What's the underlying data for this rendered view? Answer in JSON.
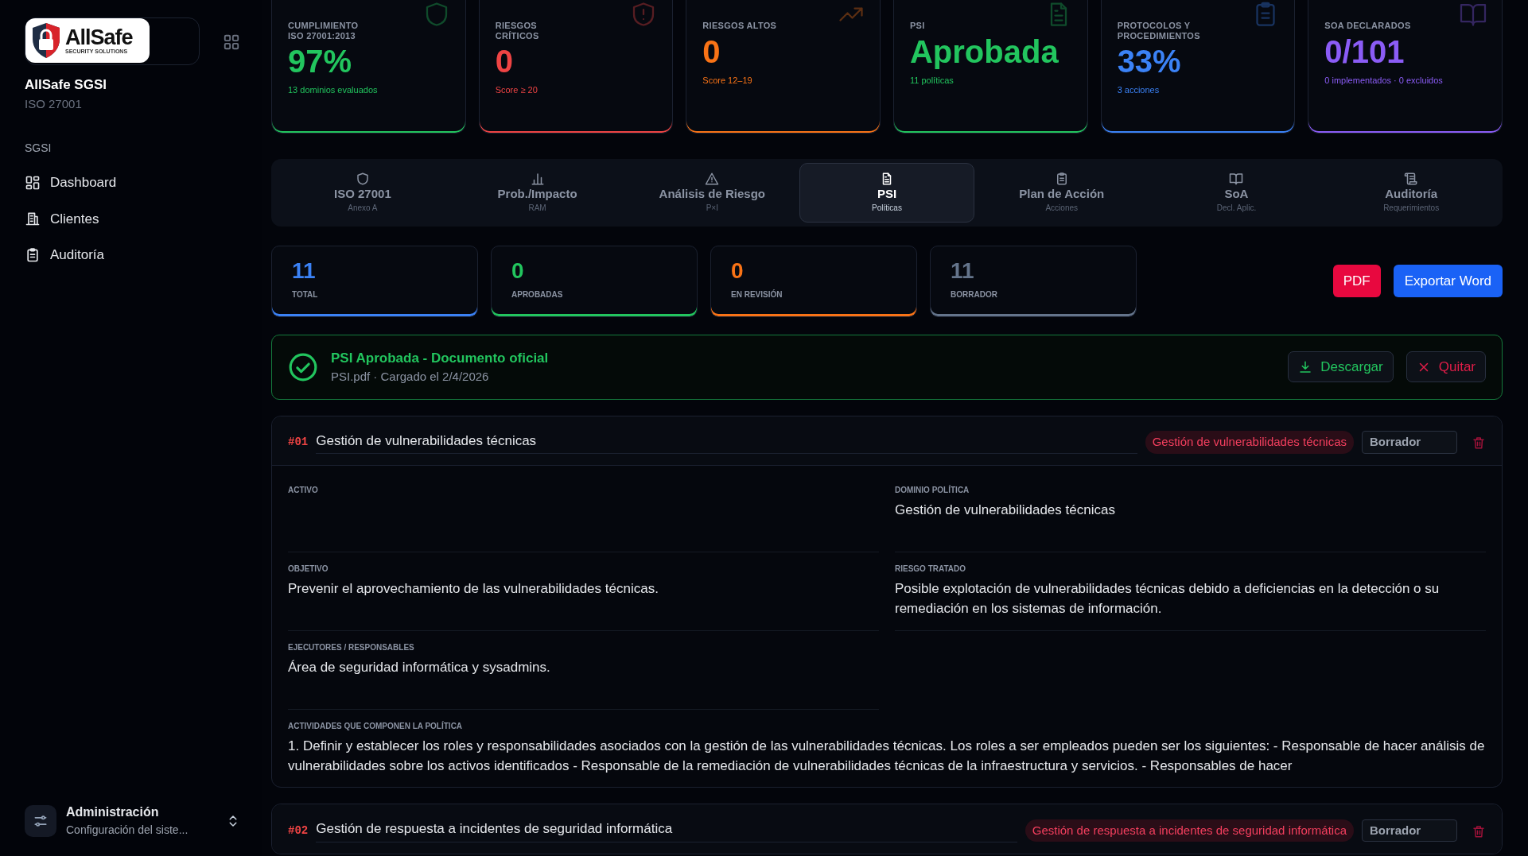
{
  "sidebar": {
    "logo_text": "AllSafe",
    "logo_tagline": "SECURITY SOLUTIONS",
    "brand_title": "AllSafe SGSI",
    "brand_subtitle": "ISO 27001",
    "section": "SGSI",
    "items": [
      {
        "label": "Dashboard",
        "selected": false
      },
      {
        "label": "Clientes",
        "selected": false
      },
      {
        "label": "Auditoría",
        "selected": false
      }
    ],
    "footer": {
      "title": "Administración",
      "subtitle": "Configuración del siste..."
    }
  },
  "kpis": [
    {
      "label": "CUMPLIMIENTO ISO 27001:2013",
      "value": "97%",
      "note": "13 dominios evaluados",
      "color": "#22c55e"
    },
    {
      "label": "RIESGOS CRÍTICOS",
      "value": "0",
      "note": "Score ≥ 20",
      "color": "#ef4444"
    },
    {
      "label": "RIESGOS ALTOS",
      "value": "0",
      "note": "Score 12–19",
      "color": "#f97316"
    },
    {
      "label": "PSI",
      "value": "Aprobada",
      "note": "11 políticas",
      "color": "#22c55e"
    },
    {
      "label": "PROTOCOLOS Y PROCEDIMIENTOS",
      "value": "33%",
      "note": "3 acciones",
      "color": "#3b82f6"
    },
    {
      "label": "SOA DECLARADOS",
      "value": "0/101",
      "note": "0 implementados · 0 excluidos",
      "color": "#8b5cf6"
    }
  ],
  "tabs": [
    {
      "label": "ISO 27001",
      "sub": "Anexo A",
      "selected": false
    },
    {
      "label": "Prob./Impacto",
      "sub": "RAM",
      "selected": false
    },
    {
      "label": "Análisis de Riesgo",
      "sub": "P×I",
      "selected": false
    },
    {
      "label": "PSI",
      "sub": "Políticas",
      "selected": true
    },
    {
      "label": "Plan de Acción",
      "sub": "Acciones",
      "selected": false
    },
    {
      "label": "SoA",
      "sub": "Decl. Aplic.",
      "selected": false
    },
    {
      "label": "Auditoría",
      "sub": "Requerimientos",
      "selected": false
    }
  ],
  "stats": [
    {
      "value": "11",
      "label": "TOTAL",
      "color": "#3b82f6"
    },
    {
      "value": "0",
      "label": "APROBADAS",
      "color": "#22c55e"
    },
    {
      "value": "0",
      "label": "EN REVISIÓN",
      "color": "#f97316"
    },
    {
      "value": "11",
      "label": "BORRADOR",
      "color": "#64748b"
    }
  ],
  "export_buttons": [
    {
      "label": "PDF",
      "kind": "pdf"
    },
    {
      "label": "Exportar Word",
      "kind": "word"
    }
  ],
  "banner": {
    "title": "PSI Aprobada - Documento oficial",
    "meta": "PSI.pdf · Cargado el 2/4/2026",
    "buttons": [
      {
        "label": "Descargar",
        "kind": "download"
      },
      {
        "label": "Quitar",
        "kind": "remove"
      }
    ]
  },
  "policies": [
    {
      "number": "#01",
      "title": "Gestión de vulnerabilidades técnicas",
      "tag": "Gestión de vulnerabilidades técnicas",
      "status": "Borrador",
      "expanded": true,
      "fields": [
        {
          "label": "ACTIVO",
          "kind": "half"
        },
        {
          "label": "DOMINIO POLÍTICA",
          "value": "Gestión de vulnerabilidades técnicas",
          "kind": "half"
        },
        {
          "label": "OBJETIVO",
          "value": "Prevenir el aprovechamiento de las vulnerabilidades técnicas.",
          "kind": "half"
        },
        {
          "label": "RIESGO TRATADO",
          "value": "Posible explotación de vulnerabilidades técnicas debido a deficiencias en la detección o su remediación en los sistemas de información.",
          "kind": "half"
        },
        {
          "label": "EJECUTORES / RESPONSABLES",
          "value": "Área de seguridad informática y sysadmins.",
          "kind": "half"
        },
        {
          "label": "ACTIVIDADES QUE COMPONEN LA POLÍTICA",
          "value": "1. Definir y establecer los roles y responsabilidades asociados con la gestión de las vulnerabilidades técnicas. Los roles a ser empleados pueden ser los siguientes: - Responsable de hacer análisis de vulnerabilidades sobre los activos identificados - Responsable de la remediación de vulnerabilidades técnicas de la infraestructura y servicios. - Responsables de hacer",
          "kind": "full"
        }
      ]
    },
    {
      "number": "#02",
      "title": "Gestión de respuesta a incidentes de seguridad informática",
      "tag": "Gestión de respuesta a incidentes de seguridad informática",
      "status": "Borrador",
      "expanded": false
    }
  ]
}
